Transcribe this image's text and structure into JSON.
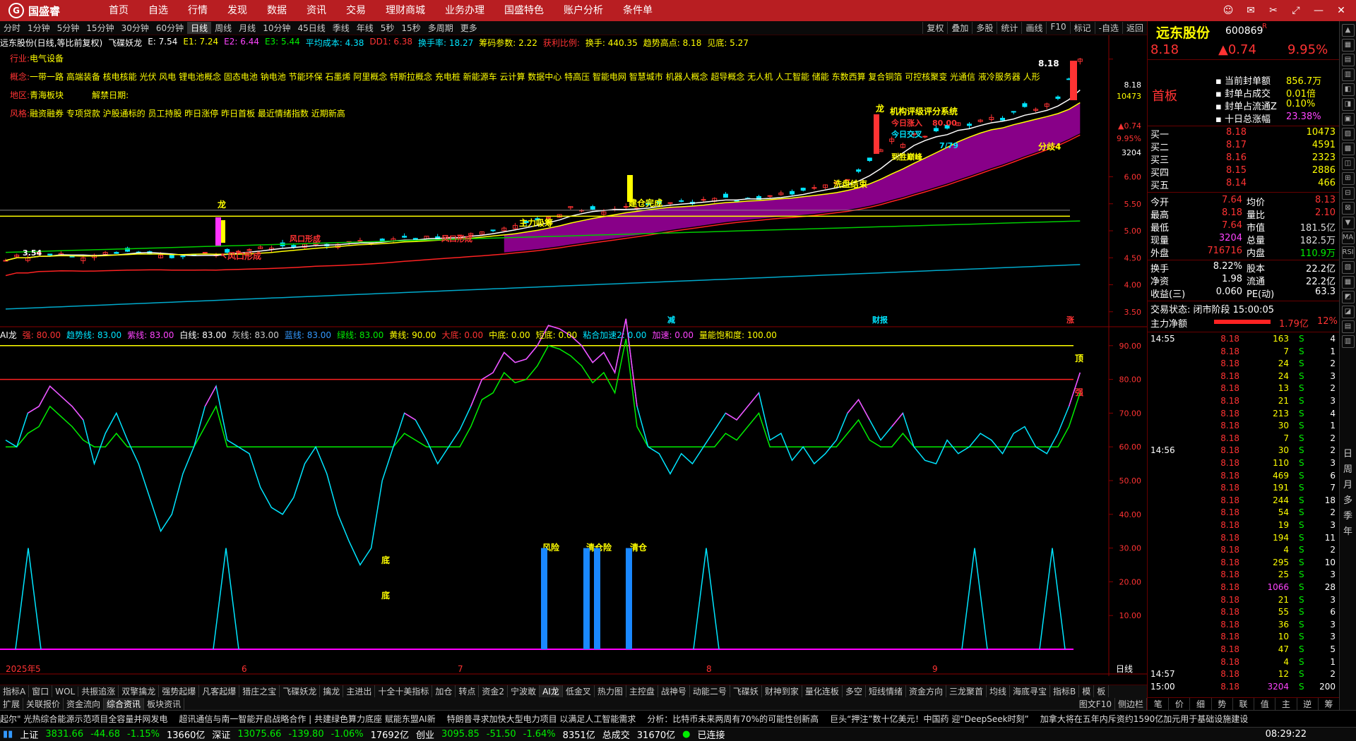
{
  "app": {
    "logo_text": "国盛睿"
  },
  "menu": [
    "首页",
    "自选",
    "行情",
    "发现",
    "数据",
    "资讯",
    "交易",
    "理财商城",
    "业务办理",
    "国盛特色",
    "账户分析",
    "条件单"
  ],
  "window_controls": [
    "☺",
    "✉",
    "✂",
    "⤢",
    "—",
    "✕"
  ],
  "periods": [
    "分时",
    "1分钟",
    "5分钟",
    "15分钟",
    "30分钟",
    "60分钟",
    "日线",
    "周线",
    "月线",
    "10分钟",
    "45日线",
    "季线",
    "年线",
    "5秒",
    "15秒",
    "多周期",
    "更多"
  ],
  "period_active": "日线",
  "right_tools": [
    "复权",
    "叠加",
    "多股",
    "统计",
    "画线",
    "F10",
    "标记",
    "-自选",
    "返回"
  ],
  "info_line": {
    "stock": "远东股份(日线,等比前复权)",
    "indicator": "飞碟妖龙",
    "E": "E: 7.54",
    "E1": "E1: 7.24",
    "E2": "E2: 6.44",
    "E3": "E3: 5.44",
    "avg": "平均成本: 4.38",
    "dd1": "DD1: 6.38",
    "turnover": "换手率: 18.27",
    "chip": "筹码参数: 2.22",
    "profit": "获利比例:",
    "hand": "换手: 440.35",
    "trend": "趋势高点: 8.18",
    "bottom": "见底: 5.27"
  },
  "industry": {
    "label": "行业:",
    "value": "电气设备"
  },
  "concept": {
    "label": "概念:",
    "value": "一带一路 高端装备 核电核能 光伏 风电 锂电池概念 固态电池 钠电池 节能环保 石墨烯 阿里概念 特斯拉概念 充电桩 新能源车 云计算 数据中心 特高压 智能电网 智慧城市 机器人概念 超导概念 无人机 人工智能 储能 东数西算 复合铜箔 可控核聚变 光通信 液冷服务器 人形"
  },
  "region": {
    "label": "地区:",
    "value": "青海板块",
    "unlock_label": "解禁日期:"
  },
  "style": {
    "label": "风格:",
    "value": "融资融券 专项贷款 沪股通标的 员工持股 昨日涨停 昨日首板 最近情绪指数 近期新高"
  },
  "price_axis": [
    "8.18",
    "6.00",
    "5.50",
    "5.00",
    "4.50",
    "4.00",
    "3.50"
  ],
  "price_axis_extra": {
    "vol": "10473",
    "chg": "▲0.74",
    "pct": "9.95%",
    "vol2": "3204"
  },
  "chart_annotations": {
    "long_1": "龙",
    "wind_mouth": "↖风口形成",
    "wind_mouth_2": "风口形成",
    "wind_mouth_3": "风口形成",
    "main_force": "主力吸筹",
    "finish_build": "建仓完成",
    "wash_end": "洗盘结束",
    "long_2": "龙",
    "rating": "机构评级评分系统",
    "today_top": "今日涨入",
    "today_cross": "今日交叉",
    "cross_val": "7/79",
    "trade_val": "80.00",
    "peak": "到胜巅峰",
    "divergence": "分歧4",
    "high_price": "8.18",
    "low_price": "3.54",
    "jian": "减",
    "caibao": "财报",
    "zhang": "涨"
  },
  "indicator_line": {
    "name": "AI龙",
    "items": [
      {
        "label": "强: 80.00",
        "color": "#ff3333"
      },
      {
        "label": "趋势线: 83.00",
        "color": "#00e5ff"
      },
      {
        "label": "紫线: 83.00",
        "color": "#ff44ff"
      },
      {
        "label": "白线: 83.00",
        "color": "#ffffff"
      },
      {
        "label": "灰线: 83.00",
        "color": "#cccccc"
      },
      {
        "label": "蓝线: 83.00",
        "color": "#3399ff"
      },
      {
        "label": "绿线: 83.00",
        "color": "#00ee00"
      },
      {
        "label": "黄线: 90.00",
        "color": "#ffff00"
      },
      {
        "label": "大底: 0.00",
        "color": "#ff3333"
      },
      {
        "label": "中底: 0.00",
        "color": "#ffff00"
      },
      {
        "label": "短底: 0.00",
        "color": "#ffff00"
      },
      {
        "label": "粘合加速2: 0.00",
        "color": "#00e5ff"
      },
      {
        "label": "加速: 0.00",
        "color": "#ff44ff"
      },
      {
        "label": "量能饱和度: 100.00",
        "color": "#ffff00"
      }
    ]
  },
  "ind_axis": [
    "90.00",
    "80.00",
    "70.00",
    "60.00",
    "50.00",
    "40.00",
    "30.00",
    "20.00",
    "10.00"
  ],
  "ind_annotations": {
    "top": "顶",
    "strong": "强",
    "bottom": "底",
    "bottom2": "底",
    "risk1": "风险",
    "risk2": "清仓险",
    "risk3": "清仓"
  },
  "date_axis": [
    "2025年",
    "5",
    "6",
    "7",
    "8",
    "9"
  ],
  "date_axis_right": "日线",
  "tabs": [
    "指标A",
    "窗口",
    "WOL",
    "共振追涨",
    "双擎擒龙",
    "强势起爆",
    "凡客起爆",
    "猎庄之宝",
    "飞碟妖龙",
    "擒龙",
    "主进出",
    "十全十美指标",
    "加仓",
    "转点",
    "资金2",
    "宁波敢",
    "AI龙",
    "低金叉",
    "热力图",
    "主控盘",
    "战神号",
    "动能二号",
    "飞碟妖",
    "财神到家",
    "量化连板",
    "多空",
    "短线情绪",
    "资金方向",
    "三龙聚首",
    "均线",
    "海底寻宝",
    "指标B",
    "模",
    "板"
  ],
  "tab_active": "AI龙",
  "subtabs": [
    "扩展",
    "关联报价",
    "资金流向",
    "综合资讯",
    "板块资讯"
  ],
  "subtab_active": "综合资讯",
  "subtab_right": [
    "图文F10",
    "侧边栏"
  ],
  "news": [
    "起尔\" 光热综合能源示范项目全容量并网发电",
    "超讯通信与南一智能开启战略合作 | 共建绿色算力底座 赋能东盟AI新",
    "特朗普寻求加快大型电力项目 以满足人工智能需求",
    "分析：比特币未来两周有70%的可能性创新高",
    "巨头“押注”数十亿美元！中国药 迎“DeepSeek时刻”",
    "加拿大将在五年内斥资约1590亿加元用于基础设施建设"
  ],
  "status": {
    "sh_label": "上证",
    "sh_val": "3831.66",
    "sh_chg": "-44.68",
    "sh_pct": "-1.15%",
    "sh_amt": "13660亿",
    "sz_label": "深证",
    "sz_val": "13075.66",
    "sz_chg": "-139.80",
    "sz_pct": "-1.06%",
    "sz_amt": "17692亿",
    "cy_label": "创业",
    "cy_val": "3095.85",
    "cy_chg": "-51.50",
    "cy_pct": "-1.64%",
    "cy_amt": "8351亿",
    "total_label": "总成交",
    "total_val": "31670亿",
    "conn": "已连接",
    "time": "08:29:22"
  },
  "quote": {
    "name": "远东股份",
    "code": "600869",
    "mark": "R",
    "price": "8.18",
    "chg": "▲0.74",
    "pct": "9.95%",
    "board": "首板",
    "seal_amt_label": "当前封单额",
    "seal_amt": "856.7万",
    "seal_ratio_label": "封单占成交",
    "seal_ratio": "0.01倍",
    "seal_float_label": "封单占流通Z",
    "seal_float": "0.10%",
    "ten_day_label": "十日总涨幅",
    "ten_day": "23.38%",
    "bids": [
      {
        "label": "买一",
        "price": "8.18",
        "vol": "10473"
      },
      {
        "label": "买二",
        "price": "8.17",
        "vol": "4591"
      },
      {
        "label": "买三",
        "price": "8.16",
        "vol": "2323"
      },
      {
        "label": "买四",
        "price": "8.15",
        "vol": "2886"
      },
      {
        "label": "买五",
        "price": "8.14",
        "vol": "466"
      }
    ],
    "stats_left": [
      {
        "label": "今开",
        "value": "7.64",
        "color": "#ff3333"
      },
      {
        "label": "最高",
        "value": "8.18",
        "color": "#ff3333"
      },
      {
        "label": "最低",
        "value": "7.64",
        "color": "#ff3333"
      },
      {
        "label": "现量",
        "value": "3204",
        "color": "#ff44ff"
      },
      {
        "label": "外盘",
        "value": "716716",
        "color": "#ff3333"
      }
    ],
    "stats_right": [
      {
        "label": "均价",
        "value": "8.13",
        "color": "#ff3333"
      },
      {
        "label": "量比",
        "value": "2.10",
        "color": "#ff3333"
      },
      {
        "label": "市值",
        "value": "181.5亿",
        "color": "#dddddd"
      },
      {
        "label": "总量",
        "value": "182.5万",
        "color": "#dddddd"
      },
      {
        "label": "内盘",
        "value": "110.9万",
        "color": "#00ee00"
      }
    ],
    "turnover_label": "换手",
    "turnover": "8.22%",
    "capital_label": "股本",
    "capital": "22.2亿",
    "nav_label": "净资",
    "nav": "1.98",
    "float_label": "流通",
    "float": "22.2亿",
    "eps_label": "收益(三)",
    "eps": "0.060",
    "pe_label": "PE(动)",
    "pe": "63.3",
    "trade_state": "交易状态: 闭市阶段 15:00:05",
    "net_label": "主力净额",
    "net_val": "1.79亿",
    "net_pct": "12%"
  },
  "ticks": [
    {
      "t": "14:55",
      "p": "8.18",
      "v": "163",
      "s": "S",
      "n": "4"
    },
    {
      "t": "",
      "p": "8.18",
      "v": "7",
      "s": "S",
      "n": "1"
    },
    {
      "t": "",
      "p": "8.18",
      "v": "24",
      "s": "S",
      "n": "2"
    },
    {
      "t": "",
      "p": "8.18",
      "v": "24",
      "s": "S",
      "n": "3"
    },
    {
      "t": "",
      "p": "8.18",
      "v": "13",
      "s": "S",
      "n": "2"
    },
    {
      "t": "",
      "p": "8.18",
      "v": "21",
      "s": "S",
      "n": "3"
    },
    {
      "t": "",
      "p": "8.18",
      "v": "213",
      "s": "S",
      "n": "4"
    },
    {
      "t": "",
      "p": "8.18",
      "v": "30",
      "s": "S",
      "n": "1"
    },
    {
      "t": "",
      "p": "8.18",
      "v": "7",
      "s": "S",
      "n": "2"
    },
    {
      "t": "14:56",
      "p": "8.18",
      "v": "30",
      "s": "S",
      "n": "2"
    },
    {
      "t": "",
      "p": "8.18",
      "v": "110",
      "s": "S",
      "n": "3"
    },
    {
      "t": "",
      "p": "8.18",
      "v": "469",
      "s": "S",
      "n": "6"
    },
    {
      "t": "",
      "p": "8.18",
      "v": "191",
      "s": "S",
      "n": "7"
    },
    {
      "t": "",
      "p": "8.18",
      "v": "244",
      "s": "S",
      "n": "18"
    },
    {
      "t": "",
      "p": "8.18",
      "v": "54",
      "s": "S",
      "n": "2"
    },
    {
      "t": "",
      "p": "8.18",
      "v": "19",
      "s": "S",
      "n": "3"
    },
    {
      "t": "",
      "p": "8.18",
      "v": "194",
      "s": "S",
      "n": "11"
    },
    {
      "t": "",
      "p": "8.18",
      "v": "4",
      "s": "S",
      "n": "2"
    },
    {
      "t": "",
      "p": "8.18",
      "v": "295",
      "s": "S",
      "n": "10"
    },
    {
      "t": "",
      "p": "8.18",
      "v": "25",
      "s": "S",
      "n": "3"
    },
    {
      "t": "",
      "p": "8.18",
      "v": "1066",
      "s": "S",
      "n": "28"
    },
    {
      "t": "",
      "p": "8.18",
      "v": "21",
      "s": "S",
      "n": "3"
    },
    {
      "t": "",
      "p": "8.18",
      "v": "55",
      "s": "S",
      "n": "6"
    },
    {
      "t": "",
      "p": "8.18",
      "v": "36",
      "s": "S",
      "n": "3"
    },
    {
      "t": "",
      "p": "8.18",
      "v": "10",
      "s": "S",
      "n": "3"
    },
    {
      "t": "",
      "p": "8.18",
      "v": "47",
      "s": "S",
      "n": "5"
    },
    {
      "t": "",
      "p": "8.18",
      "v": "4",
      "s": "S",
      "n": "1"
    },
    {
      "t": "14:57",
      "p": "8.18",
      "v": "12",
      "s": "S",
      "n": "2"
    },
    {
      "t": "15:00",
      "p": "8.18",
      "v": "3204",
      "s": "S",
      "n": "200"
    }
  ],
  "rpanel_tabs": [
    "笔",
    "价",
    "细",
    "势",
    "联",
    "值",
    "主",
    "逆",
    "筹"
  ],
  "side_icons": [
    "▲",
    "▦",
    "▤",
    "▥",
    "◧",
    "◨",
    "▣",
    "▨",
    "▩",
    "◫",
    "⊞",
    "⊟",
    "⊠",
    "▼",
    "MA",
    "RSI",
    "▧",
    "▦",
    "◩",
    "◪",
    "▤",
    "▥"
  ],
  "side_vertical": [
    "日",
    "周",
    "月",
    "多",
    "季",
    "年"
  ],
  "colors": {
    "up": "#ff3333",
    "down": "#00ee00",
    "accent": "#b81e22"
  }
}
